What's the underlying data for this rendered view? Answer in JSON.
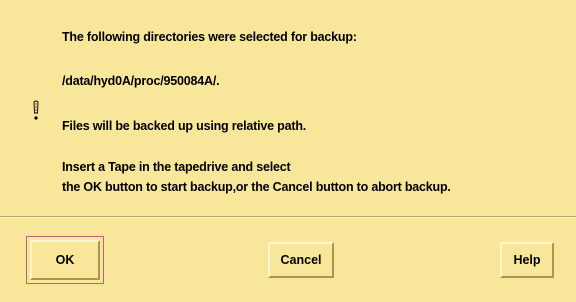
{
  "dialog": {
    "messages": [
      "The following directories were selected for backup:",
      "/data/hyd0A/proc/950084A/.",
      "Files will be backed up using relative path.",
      "Insert a Tape in the tapedrive and select",
      "the OK button to start backup,or the Cancel button to abort backup."
    ],
    "icon": "info-icon"
  },
  "buttons": {
    "ok_label": "OK",
    "cancel_label": "Cancel",
    "help_label": "Help"
  },
  "colors": {
    "background": "#f8e69a",
    "focus_ring": "#c0607a"
  }
}
